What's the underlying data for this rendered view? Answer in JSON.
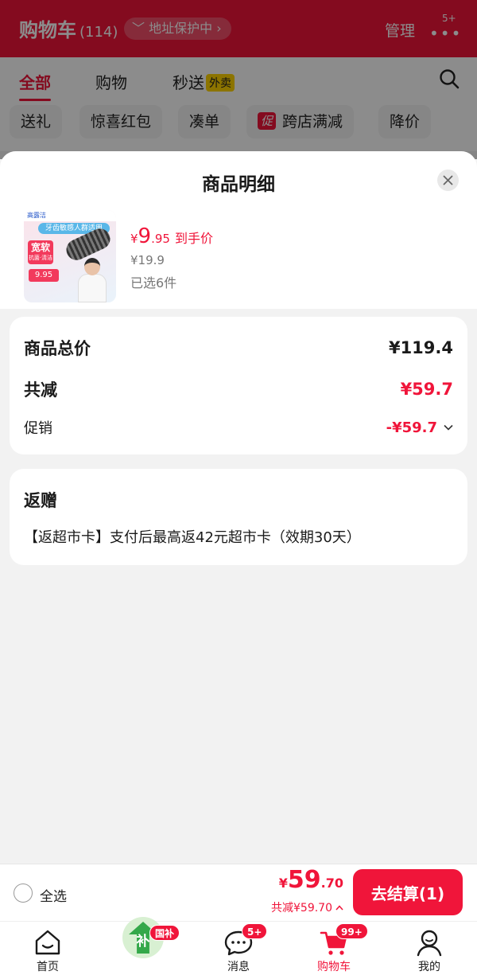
{
  "background": {
    "title": "购物车",
    "count": "(114)",
    "protect": "地址保护中",
    "manage": "管理",
    "badge": "5+",
    "tabs": [
      "全部",
      "购物",
      "秒送"
    ],
    "waimai": "外卖",
    "chips": [
      "送礼",
      "惊喜红包",
      "凑单",
      "跨店满减",
      "降价"
    ],
    "chip_cu": "促"
  },
  "sheet": {
    "title": "商品明细",
    "product": {
      "price_currency": "¥",
      "price_int": "9",
      "price_dec": ".95",
      "price_label": "到手价",
      "original_price": "¥19.9",
      "quantity": "已选6件"
    },
    "thumb": {
      "brand": "高露洁",
      "banner": "牙齿敏感人群适用",
      "soft_line1": "宽软",
      "soft_line2": "抗菌·清洁",
      "price": "9.95"
    },
    "summary": {
      "total_label": "商品总价",
      "total_value": "¥119.4",
      "discount_label": "共减",
      "discount_value": "¥59.7",
      "promo_label": "促销",
      "promo_value": "-¥59.7"
    },
    "gift": {
      "title": "返赠",
      "text": "【返超市卡】支付后最高返42元超市卡（效期30天）"
    }
  },
  "checkout": {
    "select_all": "全选",
    "currency": "¥",
    "total_int": "59",
    "total_dec": ".70",
    "saved": "共减¥59.70",
    "pay_label": "去结算(1)"
  },
  "tabbar": {
    "home": "首页",
    "guobu_badge": "国补",
    "guobu_char": "补",
    "messages": "消息",
    "messages_badge": "5+",
    "cart": "购物车",
    "cart_badge": "99+",
    "mine": "我的"
  },
  "colors": {
    "accent": "#f0153a",
    "sheet_bg": "#f2f2f2",
    "card": "#ffffff"
  }
}
